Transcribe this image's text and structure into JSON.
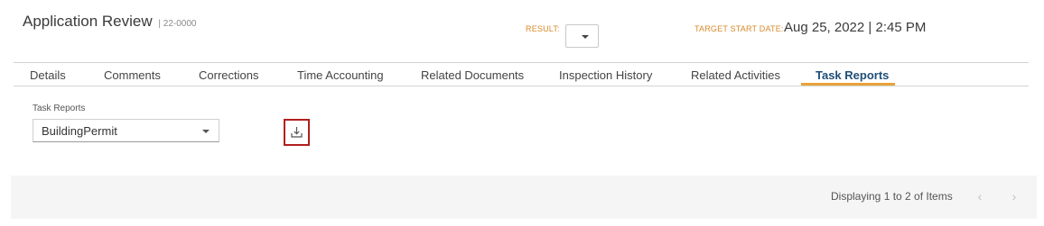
{
  "header": {
    "title": "Application Review",
    "separator": "|",
    "record_number": "22-0000",
    "result_label": "RESULT:",
    "target_start_label": "TARGET START DATE:",
    "target_start_value": "Aug 25, 2022 | 2:45 PM"
  },
  "tabs": [
    {
      "label": "Details",
      "active": false
    },
    {
      "label": "Comments",
      "active": false
    },
    {
      "label": "Corrections",
      "active": false
    },
    {
      "label": "Time Accounting",
      "active": false
    },
    {
      "label": "Related Documents",
      "active": false
    },
    {
      "label": "Inspection History",
      "active": false
    },
    {
      "label": "Related Activities",
      "active": false
    },
    {
      "label": "Task Reports",
      "active": true
    }
  ],
  "task_reports": {
    "label": "Task Reports",
    "selected": "BuildingPermit",
    "download_icon": "download-icon"
  },
  "footer": {
    "paging_text": "Displaying 1 to 2 of Items",
    "prev_icon": "chevron-left-icon",
    "next_icon": "chevron-right-icon"
  },
  "colors": {
    "accent_orange": "#d8892a",
    "active_tab": "#1f4e79",
    "tab_underline": "#e8a33c",
    "download_border": "#b11f1f"
  }
}
